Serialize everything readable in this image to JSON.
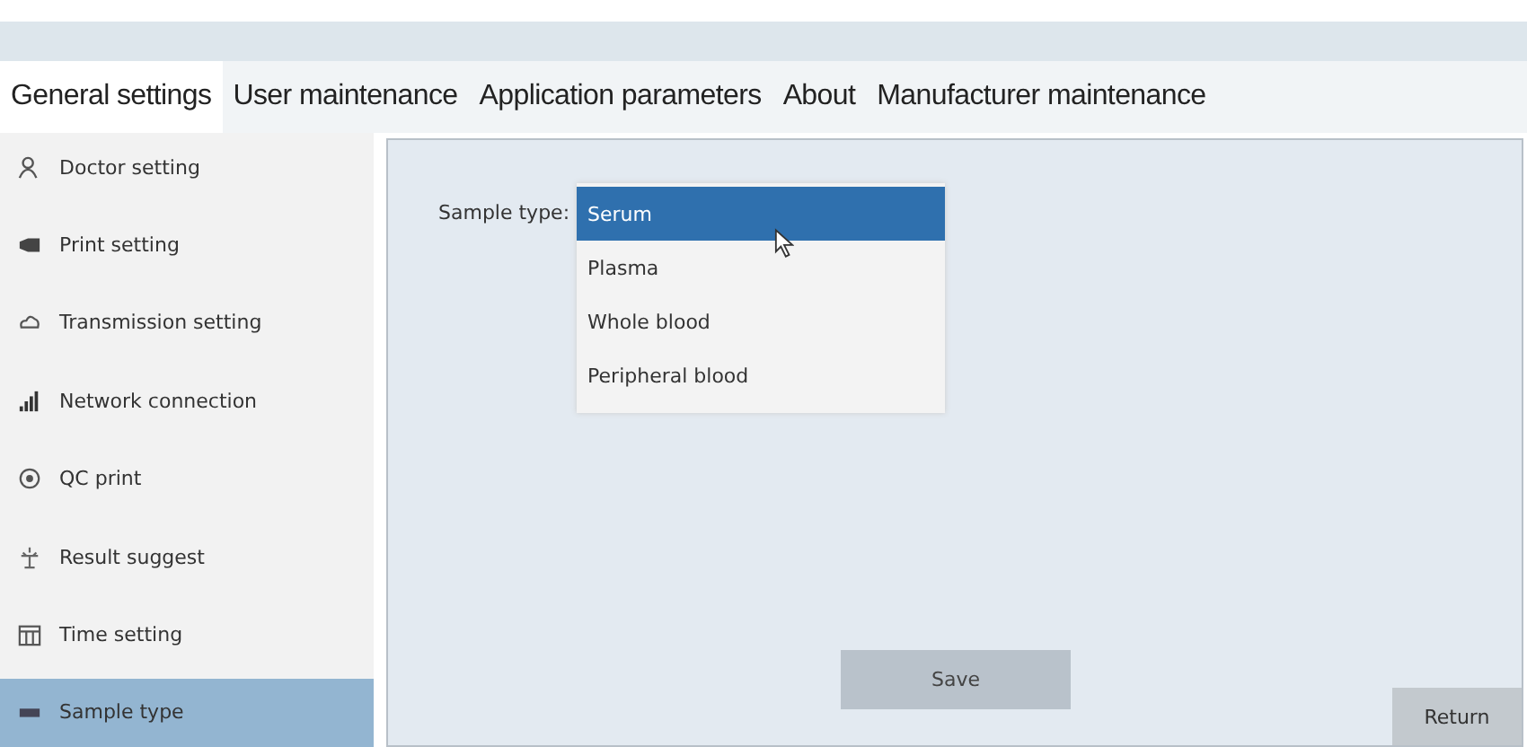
{
  "tabs": [
    {
      "label": "General settings",
      "selected": true
    },
    {
      "label": "User maintenance",
      "selected": false
    },
    {
      "label": "Application parameters",
      "selected": false
    },
    {
      "label": "About",
      "selected": false
    },
    {
      "label": "Manufacturer maintenance",
      "selected": false
    }
  ],
  "sidebar": {
    "items": [
      {
        "label": "Doctor setting",
        "selected": false
      },
      {
        "label": "Print setting",
        "selected": false
      },
      {
        "label": "Transmission setting",
        "selected": false
      },
      {
        "label": "Network connection",
        "selected": false
      },
      {
        "label": "QC print",
        "selected": false
      },
      {
        "label": "Result suggest",
        "selected": false
      },
      {
        "label": "Time setting",
        "selected": false
      },
      {
        "label": "Sample type",
        "selected": true
      }
    ]
  },
  "form": {
    "label": "Sample type:",
    "dropdown": {
      "options": [
        {
          "label": "Serum",
          "selected": true
        },
        {
          "label": "Plasma",
          "selected": false
        },
        {
          "label": "Whole blood",
          "selected": false
        },
        {
          "label": "Peripheral blood",
          "selected": false
        }
      ]
    }
  },
  "buttons": {
    "save": "Save",
    "return": "Return"
  }
}
